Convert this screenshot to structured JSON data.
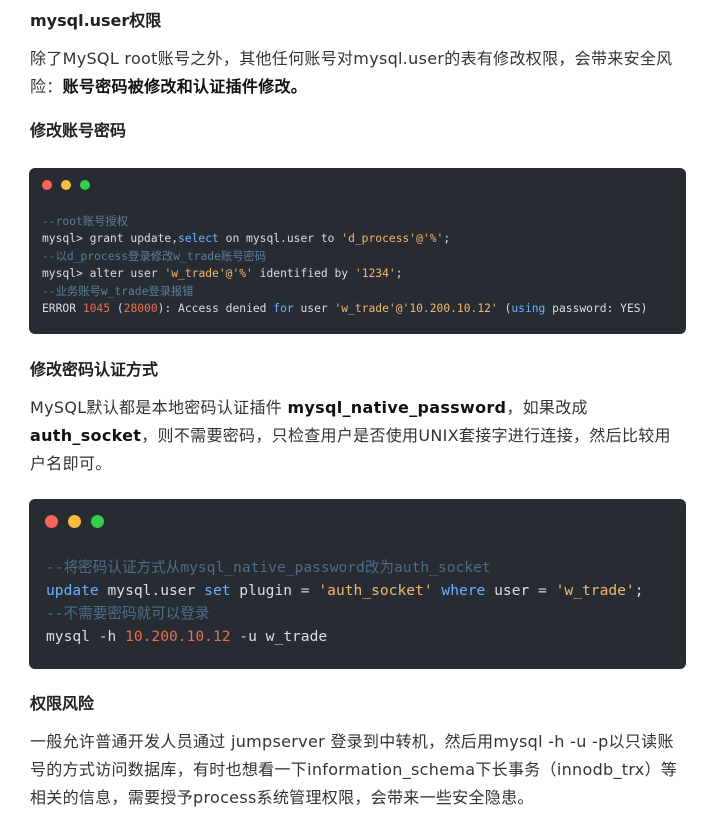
{
  "section1": {
    "title": "mysql.user权限",
    "para_before": "除了MySQL root账号之外，其他任何账号对mysql.user的表有修改权限，会带来安全风险：",
    "para_bold": "账号密码被修改和认证插件修改。"
  },
  "section2": {
    "title": "修改账号密码"
  },
  "code1": {
    "l1": "--root账号授权",
    "l2_prompt": "mysql> grant update,",
    "l2_kw": "select",
    "l2_on": " on mysql.user to ",
    "l2_str": "'d_process'@'%'",
    "l2_end": ";",
    "l3": "--以d_process登录修改w_trade账号密码",
    "l4_prompt": "mysql> alter user ",
    "l4_str1": "'w_trade'@'%'",
    "l4_mid": " identified by ",
    "l4_str2": "'1234'",
    "l4_end": ";",
    "l5": "--业务账号w_trade登录报错",
    "l6_a": "ERROR ",
    "l6_n1": "1045",
    "l6_b": " (",
    "l6_n2": "28000",
    "l6_c": "): Access denied ",
    "l6_kw1": "for",
    "l6_d": " user ",
    "l6_str": "'w_trade'@'10.200.10.12'",
    "l6_e": " (",
    "l6_kw2": "using",
    "l6_f": " password: YES)"
  },
  "section3": {
    "title": "修改密码认证方式",
    "p_a": "MySQL默认都是本地密码认证插件 ",
    "p_b1": "mysql_native_password",
    "p_c": "，如果改成",
    "p_b2": "auth_socket",
    "p_d": "，则不需要密码，只检查用户是否使用UNIX套接字进行连接，然后比较用户名即可。"
  },
  "code2": {
    "l1": "--将密码认证方式从mysql_native_password改为auth_socket",
    "l2_kw1": "update",
    "l2_a": " mysql.user ",
    "l2_kw2": "set",
    "l2_b": " plugin = ",
    "l2_str1": "'auth_socket'",
    "l2_kw3": " where",
    "l2_c": " user = ",
    "l2_str2": "'w_trade'",
    "l2_end": ";",
    "l3": "--不需要密码就可以登录",
    "l4_a": "mysql -h ",
    "l4_num": "10.200.10.12",
    "l4_b": " -u w_trade"
  },
  "section4": {
    "title": "权限风险",
    "para": "一般允许普通开发人员通过 jumpserver 登录到中转机，然后用mysql -h -u -p以只读账号的方式访问数据库，有时也想看一下information_schema下长事务（innodb_trx）等相关的信息，需要授予process系统管理权限，会带来一些安全隐患。"
  },
  "colors": {
    "code_bg": "#272c33",
    "comment": "#5c7d9b",
    "keyword": "#6cb4ff",
    "string": "#f2b96b",
    "number": "#e8704f",
    "dot_red": "#fc625d",
    "dot_yellow": "#fdbc40",
    "dot_green": "#35cd4b"
  }
}
